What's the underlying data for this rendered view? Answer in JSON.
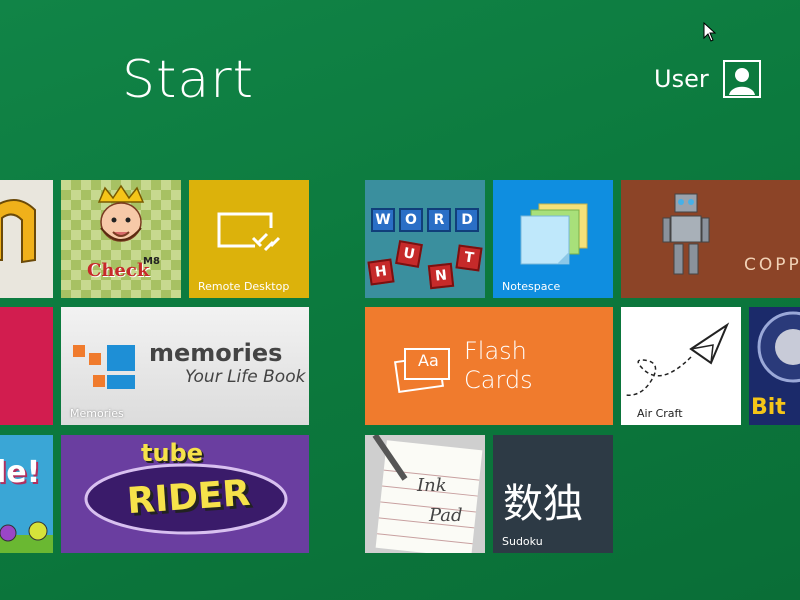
{
  "header": {
    "title": "Start",
    "user_name": "User"
  },
  "tiles": {
    "check": {
      "label": "CheckM8",
      "word": "Check",
      "badge": "M8"
    },
    "remote": {
      "label": "Remote Desktop"
    },
    "word_hunt": {
      "letters_top": [
        "W",
        "O",
        "R",
        "D"
      ],
      "letters_bottom": [
        "H",
        "U",
        "N",
        "T"
      ]
    },
    "notespace": {
      "label": "Notespace"
    },
    "copper": {
      "label": "COPP"
    },
    "memories": {
      "label": "Memories",
      "word": "memories",
      "sub": "Your Life Book"
    },
    "flash": {
      "line1": "Flash",
      "line2": "Cards",
      "icon_text": "Aa"
    },
    "aircraft": {
      "label": "Air Craft"
    },
    "bit": {
      "label": "Bit"
    },
    "tube": {
      "top": "tube",
      "main": "RIDER"
    },
    "inkpad": {
      "line1": "Ink",
      "line2": "Pad"
    },
    "sudoku": {
      "label": "Sudoku",
      "glyphs": "数独"
    },
    "left_game": {
      "text": "le!"
    }
  }
}
